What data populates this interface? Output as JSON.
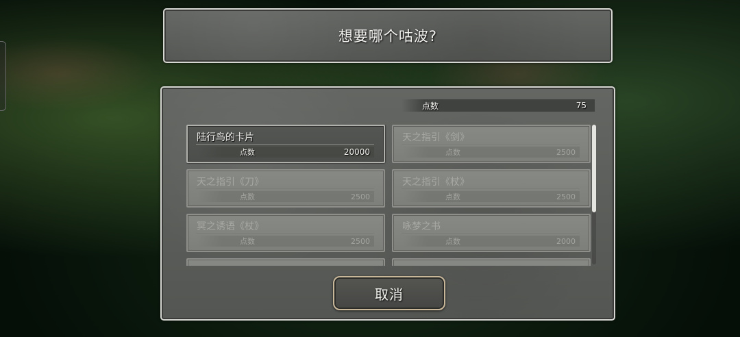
{
  "header": {
    "title": "想要哪个咕波?"
  },
  "points": {
    "label": "点数",
    "value": "75"
  },
  "items": [
    {
      "name": "陆行鸟的卡片",
      "cost_label": "点数",
      "cost": "20000"
    },
    {
      "name": "天之指引《剑》",
      "cost_label": "点数",
      "cost": "2500"
    },
    {
      "name": "天之指引《刀》",
      "cost_label": "点数",
      "cost": "2500"
    },
    {
      "name": "天之指引《杖》",
      "cost_label": "点数",
      "cost": "2500"
    },
    {
      "name": "冥之诱语《杖》",
      "cost_label": "点数",
      "cost": "2500"
    },
    {
      "name": "咏梦之书",
      "cost_label": "点数",
      "cost": "2000"
    },
    {
      "name": "",
      "cost_label": "",
      "cost": ""
    },
    {
      "name": "",
      "cost_label": "",
      "cost": ""
    }
  ],
  "selected_index": 0,
  "scroll_position": 0,
  "cancel": {
    "label": "取消"
  }
}
